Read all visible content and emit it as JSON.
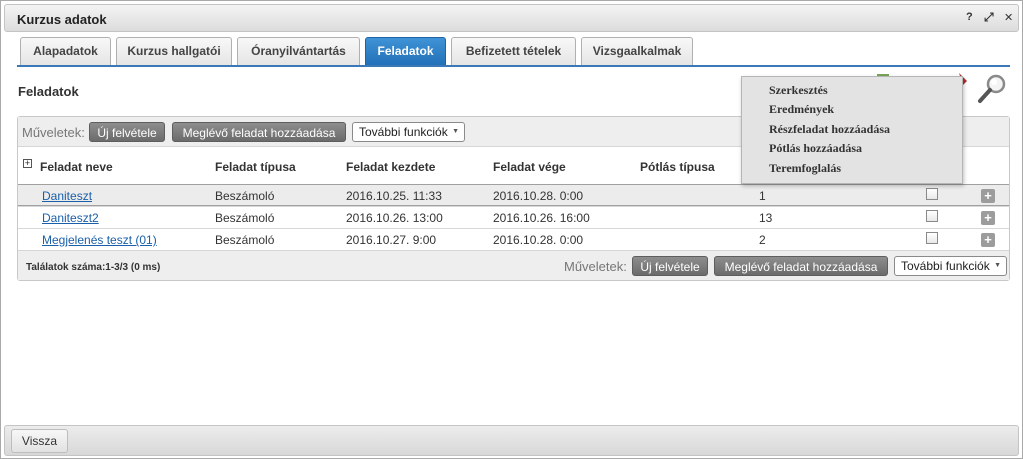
{
  "window": {
    "title": "Kurzus adatok",
    "help_label": "?",
    "popout_label": "⤢",
    "close_label": "✕"
  },
  "tabs": [
    {
      "label": "Alapadatok"
    },
    {
      "label": "Kurzus hallgatói"
    },
    {
      "label": "Óranyilvántartás"
    },
    {
      "label": "Feladatok"
    },
    {
      "label": "Befizetett tételek"
    },
    {
      "label": "Vizsgaalkalmak"
    }
  ],
  "section_title": "Feladatok",
  "menu": {
    "items": [
      {
        "label": "Szerkesztés"
      },
      {
        "label": "Eredmények"
      },
      {
        "label": "Részfeladat hozzáadása"
      },
      {
        "label": "Pótlás hozzáadása"
      },
      {
        "label": "Teremfoglalás"
      }
    ]
  },
  "toolbar": {
    "label": "Műveletek:",
    "new_label": "Új felvétele",
    "add_existing_label": "Meglévő feladat hozzáadása",
    "more_label": "További funkciók",
    "caret": "▼"
  },
  "table": {
    "expand_label": "+",
    "columns": [
      "Feladat neve",
      "Feladat típusa",
      "Feladat kezdete",
      "Feladat vége",
      "Pótlás típusa"
    ],
    "rows": [
      {
        "name": "Daniteszt",
        "type": "Beszámoló",
        "start": "2016.10.25. 11:33",
        "end": "2016.10.28. 0:00",
        "count": "1"
      },
      {
        "name": "Daniteszt2",
        "type": "Beszámoló",
        "start": "2016.10.26. 13:00",
        "end": "2016.10.26. 16:00",
        "count": "13"
      },
      {
        "name": "Megjelenés teszt (01)",
        "type": "Beszámoló",
        "start": "2016.10.27. 9:00",
        "end": "2016.10.28. 0:00",
        "count": "2"
      }
    ],
    "row_plus_label": "+"
  },
  "footer": {
    "results": "Találatok száma:1-3/3 (0 ms)",
    "label": "Műveletek:",
    "new_label": "Új felvétele",
    "add_existing_label": "Meglévő feladat hozzáadása",
    "more_label": "További funkciók",
    "caret": "▼"
  },
  "bottom": {
    "back_label": "Vissza"
  },
  "colors": {
    "active_tab": "#2b7cc4",
    "link": "#1a5fa8",
    "dark_button": "#7a7a7a"
  }
}
